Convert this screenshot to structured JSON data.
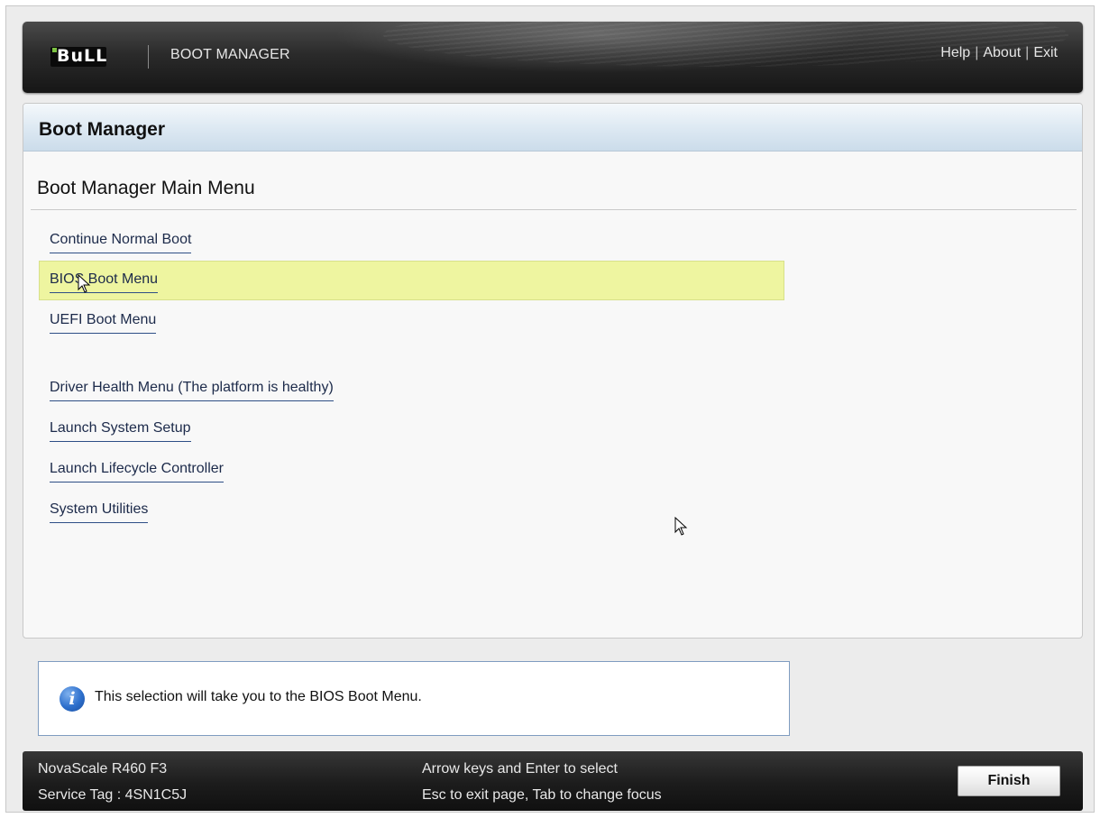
{
  "header": {
    "logo_text": "BuLL",
    "app_title": "BOOT MANAGER",
    "links": [
      "Help",
      "About",
      "Exit"
    ],
    "separator": "|"
  },
  "panel": {
    "title": "Boot Manager",
    "section_title": "Boot Manager Main Menu",
    "menu_items": [
      {
        "label": "Continue Normal Boot",
        "selected": false
      },
      {
        "label": "BIOS Boot Menu",
        "selected": true
      },
      {
        "label": "UEFI Boot Menu",
        "selected": false
      },
      {
        "label": "Driver Health Menu (The platform is healthy)",
        "selected": false
      },
      {
        "label": "Launch System Setup",
        "selected": false
      },
      {
        "label": "Launch Lifecycle Controller",
        "selected": false
      },
      {
        "label": "System Utilities",
        "selected": false
      }
    ]
  },
  "info": {
    "icon": "info-icon",
    "text": "This selection will take you to the BIOS Boot Menu."
  },
  "footer": {
    "model": "NovaScale R460 F3",
    "service_tag": "Service Tag : 4SN1C5J",
    "hint_1": "Arrow keys and Enter to select",
    "hint_2": "Esc to exit page, Tab to change focus",
    "finish_label": "Finish"
  },
  "colors": {
    "selected_row": "#eef5a0",
    "link_underline": "#2e4f86",
    "header_bar": "#2b2b2b",
    "panel_header": "#dce8f2"
  }
}
